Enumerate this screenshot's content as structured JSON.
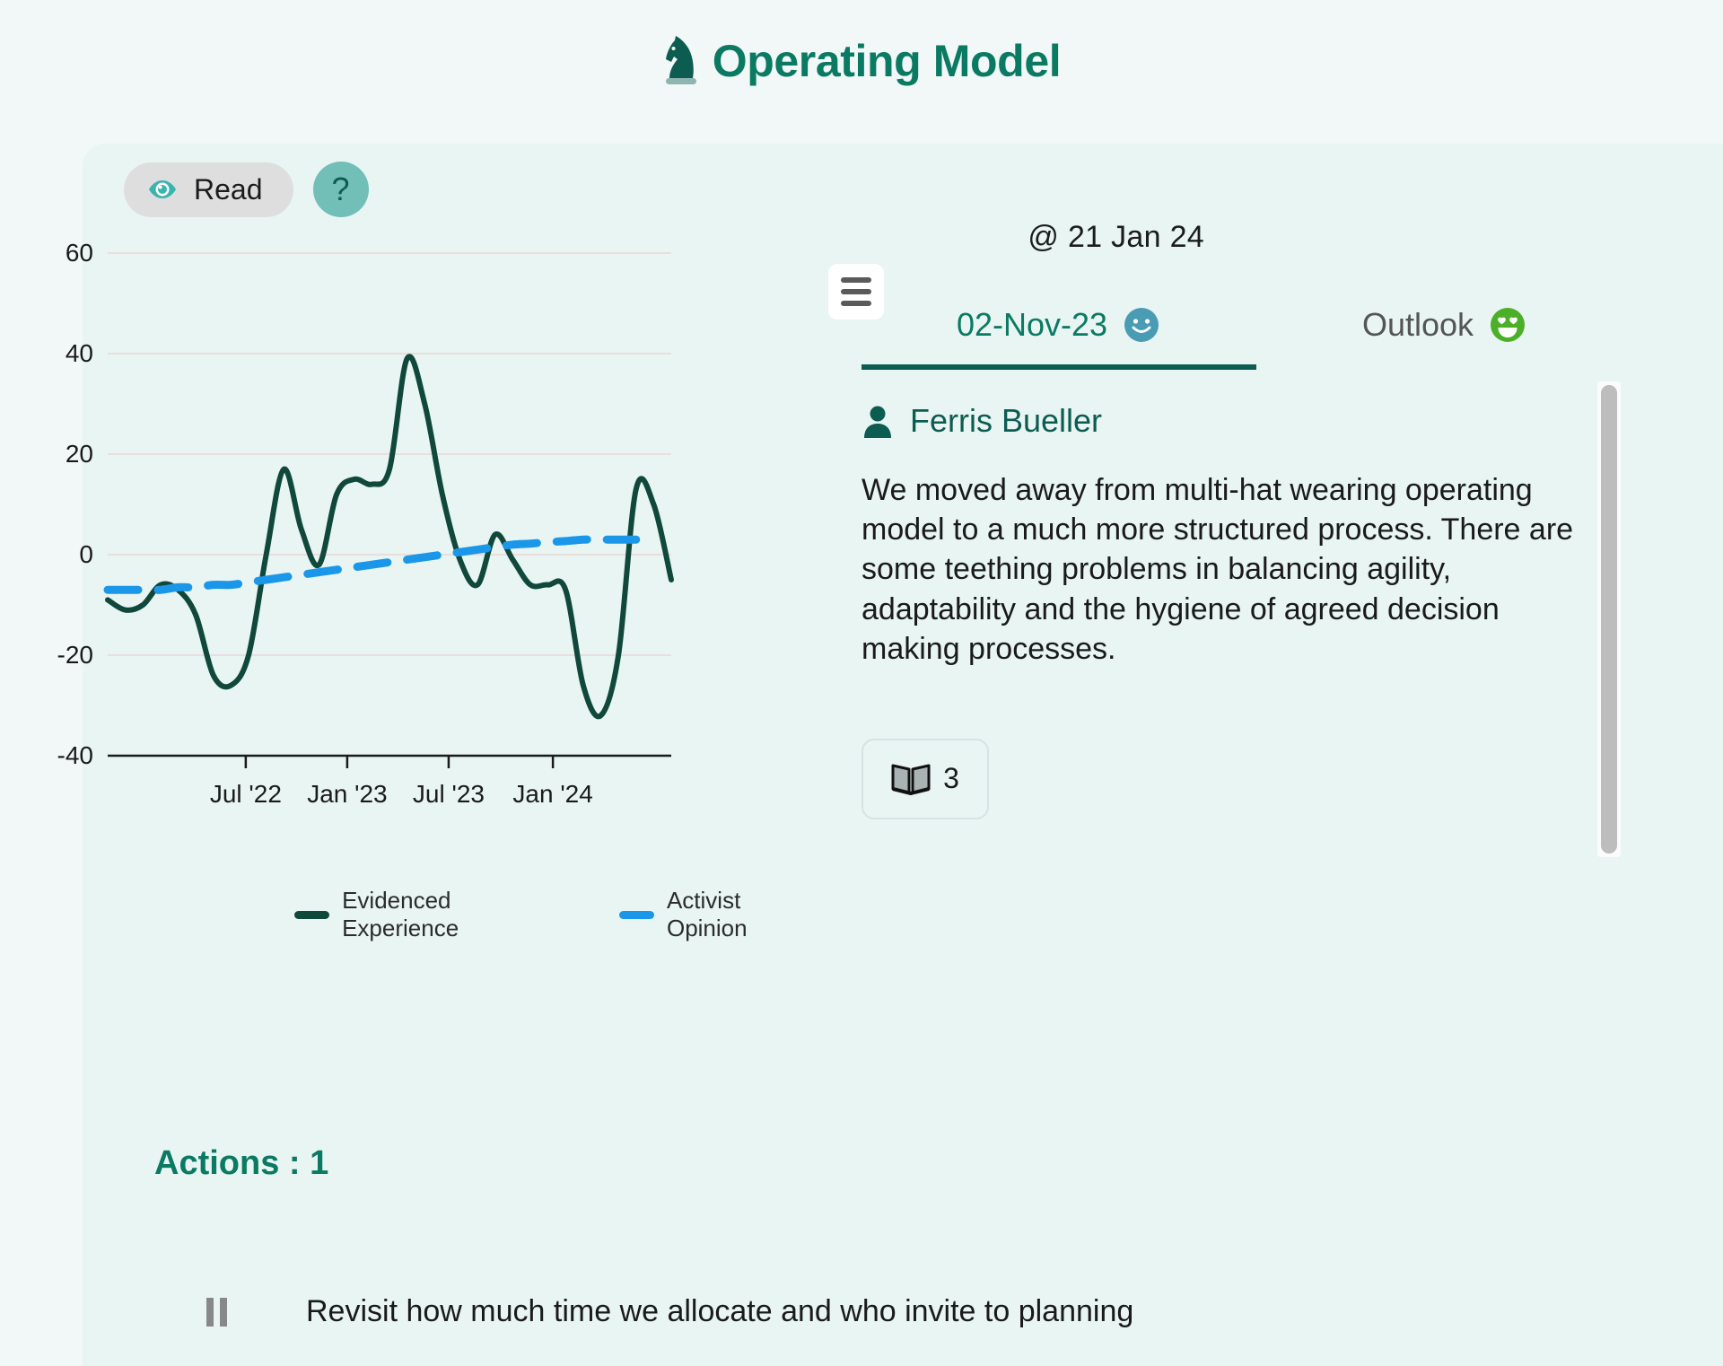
{
  "header": {
    "title": "Operating Model",
    "logo_icon": "chess-knight-icon"
  },
  "as_of": "@ 21 Jan 24",
  "controls": {
    "read_label": "Read",
    "read_icon": "eye-icon",
    "help_label": "?"
  },
  "chart_menu": {
    "icon": "hamburger-menu-icon"
  },
  "tabs": [
    {
      "label": "02-Nov-23",
      "emoji": "slightly-smiling-face",
      "emoji_color": "#4a9cb5",
      "active": true
    },
    {
      "label": "Outlook",
      "emoji": "heart-eyes-smiling-face",
      "emoji_color": "#4caf28",
      "active": false
    }
  ],
  "comment": {
    "author": "Ferris Bueller",
    "author_icon": "person-icon",
    "text": "We moved away from multi-hat wearing operating model to a much more structured process. There are some teething problems in balancing agility, adaptability and the hygiene of agreed decision making processes.",
    "book_count": "3",
    "book_icon": "open-book-icon"
  },
  "actions": {
    "title": "Actions : 1",
    "items": [
      {
        "status_icon": "pause-icon",
        "text": "Revisit how much time we allocate and who invite to planning"
      }
    ]
  },
  "colors": {
    "page_bg": "#f1f8f7",
    "card_bg": "#e8f5f3",
    "brand_teal": "#0b7a63",
    "dark_teal": "#0d5c52",
    "series_green": "#10483b",
    "series_blue": "#1a97e8",
    "help_btn": "#72bfb8"
  },
  "chart_data": {
    "type": "line",
    "title": "",
    "xlabel": "",
    "ylabel": "",
    "ylim": [
      -40,
      60
    ],
    "yticks": [
      -40,
      -20,
      0,
      20,
      40,
      60
    ],
    "xticks": [
      "Jul '22",
      "Jan '23",
      "Jul '23",
      "Jan '24"
    ],
    "grid": true,
    "legend_position": "bottom",
    "x": [
      0,
      1,
      2,
      3,
      4,
      5,
      6,
      7,
      8,
      9,
      10,
      11,
      12,
      13,
      14,
      15,
      16,
      17,
      18,
      19,
      20,
      21,
      22,
      23,
      24,
      25,
      26,
      27,
      28,
      29,
      30
    ],
    "series": [
      {
        "name": "Evidenced Experience",
        "color": "#10483b",
        "style": "solid",
        "values": [
          -9,
          -11,
          -10,
          -6,
          -7,
          -12,
          -24,
          -26,
          -20,
          0,
          17,
          5,
          -2,
          12,
          15,
          14,
          17,
          39,
          30,
          12,
          -1,
          -6,
          4,
          -1,
          -6,
          -6,
          -7,
          -26,
          -32,
          -20,
          13,
          10,
          -5
        ]
      },
      {
        "name": "Activist Opinion",
        "color": "#1a97e8",
        "style": "dashed",
        "values": [
          -7,
          -7,
          -7,
          -7,
          -6.5,
          -6.5,
          -6,
          -6,
          -5.5,
          -5,
          -4.5,
          -4,
          -3.5,
          -3,
          -2.5,
          -2,
          -1.5,
          -1,
          -0.5,
          0,
          0.5,
          1,
          1.5,
          2,
          2.2,
          2.5,
          2.7,
          3,
          3,
          3,
          3
        ]
      }
    ]
  }
}
